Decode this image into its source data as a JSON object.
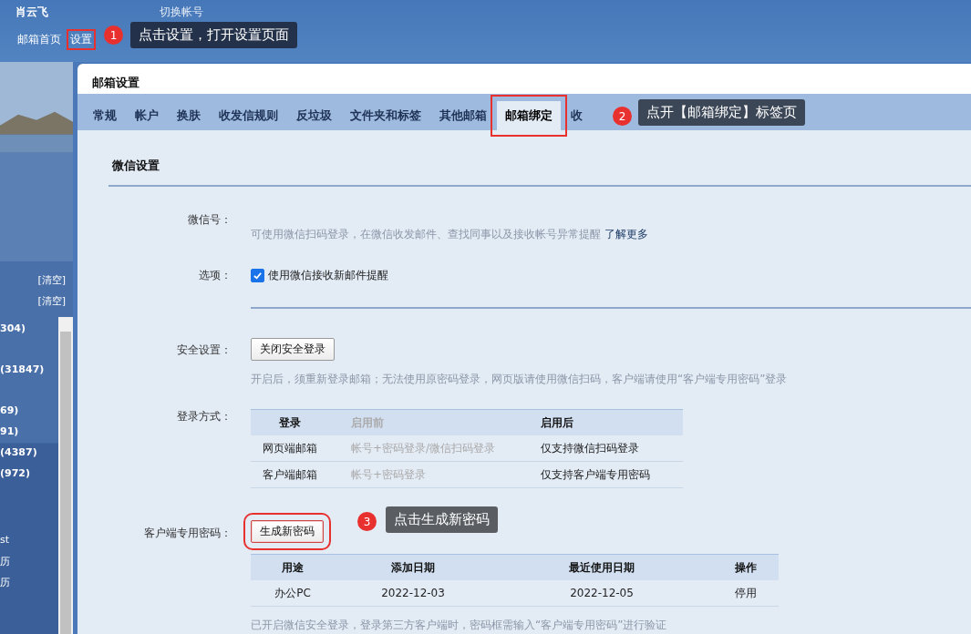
{
  "header": {
    "user": "肖云飞",
    "switch_account": "切换帐号",
    "nav": [
      {
        "label": "邮箱首页",
        "highlighted": false
      },
      {
        "label": "设置",
        "highlighted": true
      }
    ]
  },
  "sidebar": {
    "clear_links": [
      "[清空]",
      "[清空]"
    ],
    "folders": [
      "304)",
      "(31847)",
      "69)",
      "91)",
      "(4387)",
      "(972)",
      "st",
      "历",
      "历"
    ]
  },
  "panel": {
    "title": "邮箱设置",
    "tabs": [
      {
        "label": "常规",
        "selected": false,
        "highlighted": false
      },
      {
        "label": "帐户",
        "selected": false,
        "highlighted": false
      },
      {
        "label": "换肤",
        "selected": false,
        "highlighted": false
      },
      {
        "label": "收发信规则",
        "selected": false,
        "highlighted": false
      },
      {
        "label": "反垃圾",
        "selected": false,
        "highlighted": false
      },
      {
        "label": "文件夹和标签",
        "selected": false,
        "highlighted": false
      },
      {
        "label": "其他邮箱",
        "selected": false,
        "highlighted": false
      },
      {
        "label": "邮箱绑定",
        "selected": true,
        "highlighted": true
      },
      {
        "label": "收",
        "selected": false,
        "highlighted": false
      }
    ],
    "section_title": "微信设置",
    "wechat": {
      "label": "微信号：",
      "hint": "可使用微信扫码登录，在微信收发邮件、查找同事以及接收帐号异常提醒",
      "link": "了解更多"
    },
    "option": {
      "label": "选项：",
      "checkbox": {
        "label": "使用微信接收新邮件提醒",
        "checked": true
      }
    },
    "security": {
      "label": "安全设置：",
      "button": "关闭安全登录",
      "hint": "开启后，须重新登录邮箱；无法使用原密码登录，网页版请使用微信扫码，客户端请使用“客户端专用密码”登录"
    },
    "login_methods": {
      "label": "登录方式：",
      "columns": [
        "登录",
        "启用前",
        "启用后"
      ],
      "rows": [
        [
          "网页端邮箱",
          "帐号+密码登录/微信扫码登录",
          "仅支持微信扫码登录"
        ],
        [
          "客户端邮箱",
          "帐号+密码登录",
          "仅支持客户端专用密码"
        ]
      ]
    },
    "client_password": {
      "label": "客户端专用密码：",
      "button": {
        "label": "生成新密码",
        "highlighted": true
      },
      "columns": [
        "用途",
        "添加日期",
        "最近使用日期",
        "操作"
      ],
      "rows": [
        [
          "办公PC",
          "2022-12-03",
          "2022-12-05",
          "停用"
        ]
      ],
      "note": "已开启微信安全登录，登录第三方客户端时，密码框需输入“客户端专用密码”进行验证"
    }
  },
  "annotations": [
    {
      "number": "1",
      "text": "点击设置，打开设置页面"
    },
    {
      "number": "2",
      "text": "点开【邮箱绑定】标签页"
    },
    {
      "number": "3",
      "text": "点击生成新密码"
    }
  ]
}
